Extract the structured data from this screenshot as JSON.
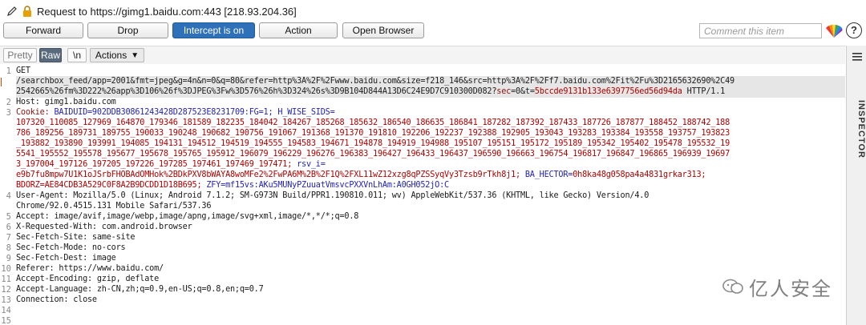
{
  "header": {
    "title": "Request to https://gimg1.baidu.com:443  [218.93.204.36]"
  },
  "toolbar": {
    "forward": "Forward",
    "drop": "Drop",
    "intercept": "Intercept is on",
    "action": "Action",
    "open_browser": "Open Browser",
    "comment_placeholder": "Comment this item"
  },
  "editor_tabs": {
    "pretty": "Pretty",
    "raw": "Raw",
    "newline": "\\n",
    "actions": "Actions"
  },
  "sidebar": {
    "inspector": "INSPECTOR"
  },
  "line_numbers": [
    "1",
    "",
    "",
    "2",
    "3",
    "",
    "",
    "",
    "",
    "",
    "",
    "",
    "",
    "4",
    "",
    "5",
    "6",
    "7",
    "8",
    "9",
    "10",
    "11",
    "12",
    "13",
    "14",
    "15"
  ],
  "request": {
    "line1": "GET",
    "line1b": "/searchbox_feed/app=2001&fmt=jpeg&g=4n&n=0&q=80&refer=http%3A%2F%2Fwww.baidu.com&size=f218_146&src=http%3A%2F%2Ff7.baidu.com%2Fit%2Fu%3D2165632690%2C49",
    "line1c_a": "2542665%26fm%3D222%26app%3D106%26f%3DJPEG%3Fw%3D576%26h%3D324%26s%3D9B104D844A13D6C24E9D7C910300D082?",
    "line1c_sec_k": "sec",
    "line1c_sec_v": "=0&t=",
    "line1c_t": "5bccde9131b133e6397756ed56d94da",
    "line1c_proto": " HTTP/1.1",
    "host": "Host: gimg1.baidu.com",
    "cookie_k": "Cookie: ",
    "cookie_baiduid": "BAIDUID=902DDB30861243428D287523E8231709:FG=1; ",
    "cookie_hwise": "H_WISE_SIDS=",
    "sids1": "107320_110085_127969_164870_179346_181589_182235_184042_184267_185268_185632_186540_186635_186841_187282_187392_187433_187726_187877_188452_188742_188",
    "sids2": "786_189256_189731_189755_190033_190248_190682_190756_191067_191368_191370_191810_192206_192237_192388_192905_193043_193283_193384_193558_193757_193823",
    "sids3": "_193882_193890_193991_194085_194131_194512_194519_194555_194583_194671_194878_194919_194988_195107_195151_195172_195189_195342_195402_195478_195532_19",
    "sids4": "5541_195552_195578_195677_195678_195765_195912_196079_196229_196276_196383_196427_196433_196437_196590_196663_196754_196817_196847_196865_196939_19697",
    "sids5_a": "3_197004_197126_197205_197226_197285_197461_197469_197471; ",
    "sids5_b": "rsv_i=",
    "rsv1": "e9b7fu8mpw7U1K1oJSrbFHOBAdOMHok%2BDkPXV8bWAYA8woMFe2%2FwPA6M%2B%2F1Q%2FXL11wZ12xzg8qPZSSyqVy3Tzsb9rTkh8j1; ",
    "hector_k": "BA_HECTOR=",
    "hector_v": "0h8ka48g058pa4a4831grkar313;",
    "bdorz": "BDORZ=AE84CDB3A529C0F8A2B9DCDD1D18B695; ",
    "zfy": "ZFY=mf15vs:AKu5MUNyPZuuatVmsvcPXXVnLhAm:A0GH052jO:C",
    "ua": "User-Agent: Mozilla/5.0 (Linux; Android 7.1.2; SM-G973N Build/PPR1.190810.011; wv) AppleWebKit/537.36 (KHTML, like Gecko) Version/4.0",
    "ua2": "Chrome/92.0.4515.131 Mobile Safari/537.36",
    "accept": "Accept: image/avif,image/webp,image/apng,image/svg+xml,image/*,*/*;q=0.8",
    "xrw": "X-Requested-With: com.android.browser",
    "sfs": "Sec-Fetch-Site: same-site",
    "sfm": "Sec-Fetch-Mode: no-cors",
    "sfd": "Sec-Fetch-Dest: image",
    "referer": "Referer: https://www.baidu.com/",
    "ae": "Accept-Encoding: gzip, deflate",
    "al": "Accept-Language: zh-CN,zh;q=0.9,en-US;q=0.8,en;q=0.7",
    "conn": "Connection: close"
  },
  "watermark": {
    "text": "亿人安全"
  }
}
